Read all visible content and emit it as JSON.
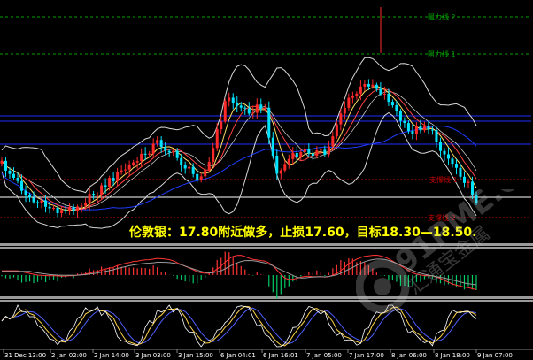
{
  "colors": {
    "background": "#000000",
    "candle_up": "#ff2a2a",
    "candle_down": "#00e5ff",
    "bollinger": "#d8d8d8",
    "ma_fast": "#ffe066",
    "ma_slow": "#ff4444",
    "ma_long": "#1e3cff",
    "macd_up": "#00cc66",
    "macd_down": "#ff3333",
    "stoch_k": "#ffffff",
    "stoch_d": "#ffd24a",
    "stoch_e": "#5060ff",
    "annotation": "#ffff00",
    "level_resistance": "#00a000",
    "level_support": "#c00000",
    "level_pivot": "#2030ff"
  },
  "chart_data": {
    "type": "candlestick",
    "x_ticks": [
      "31 Dec 13:00",
      "2 Jan 02:00",
      "2 Jan 14:00",
      "3 Jan 03:00",
      "3 Jan 15:00",
      "6 Jan 04:01",
      "6 Jan 16:01",
      "7 Jan 05:00",
      "7 Jan 17:00",
      "8 Jan 06:00",
      "8 Jan 18:00",
      "9 Jan 07:00"
    ],
    "levels": [
      {
        "name": "阻力线 2",
        "style": "dotted",
        "kind": "resistance"
      },
      {
        "name": "阻力线 1",
        "style": "dotted",
        "kind": "resistance"
      },
      {
        "name": "支撑线 1",
        "style": "dotted",
        "kind": "support"
      },
      {
        "name": "支撑线 2",
        "style": "dotted",
        "kind": "support"
      }
    ],
    "annotation": "伦敦银：17.80附近做多，止损17.60，目标18.30—18.50."
  }
}
